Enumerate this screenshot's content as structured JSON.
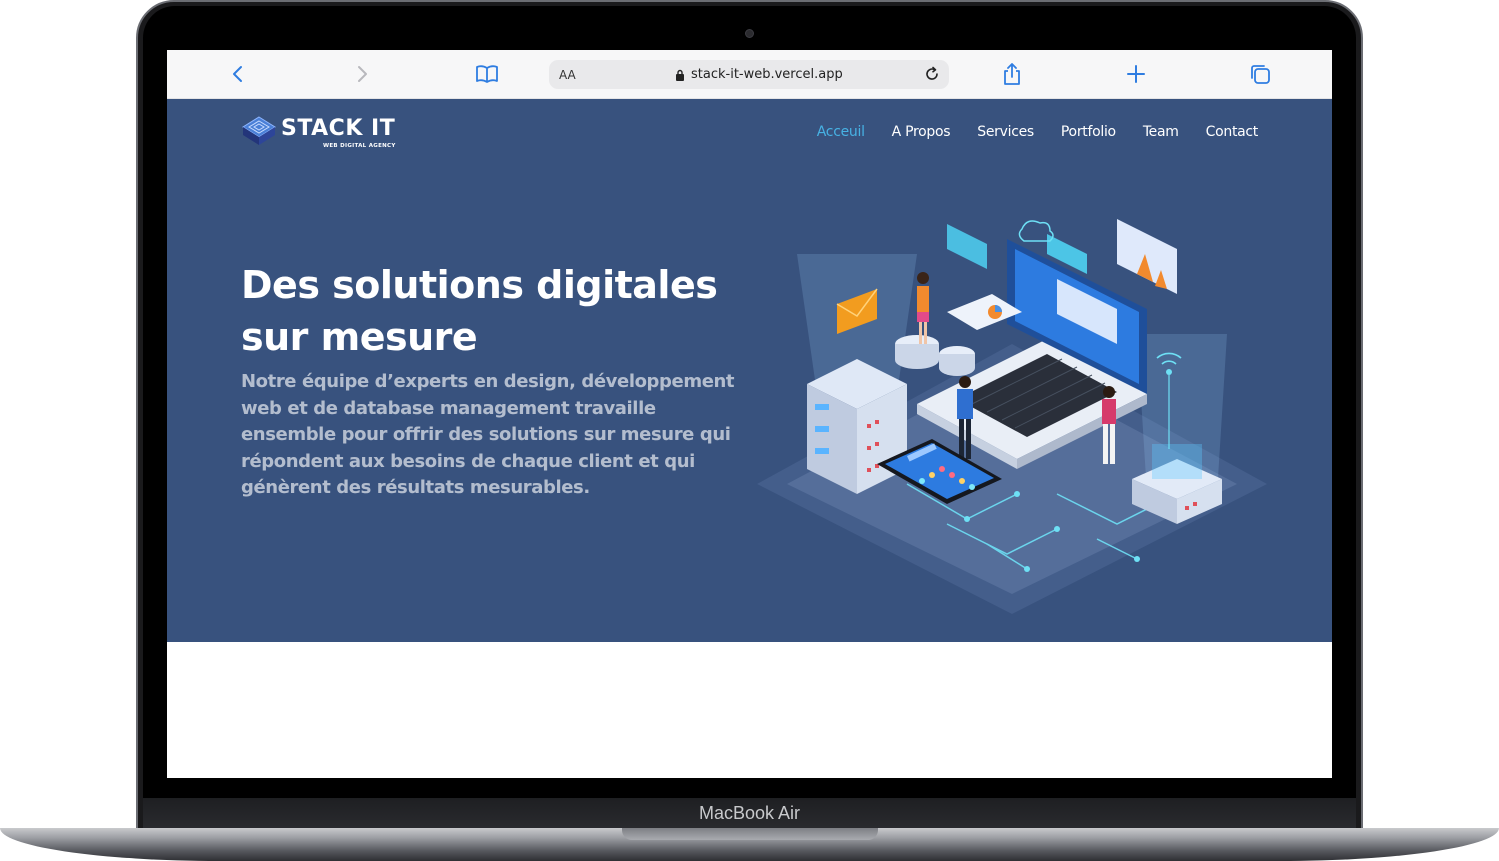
{
  "device": {
    "label": "MacBook Air"
  },
  "browser": {
    "text_size_label": "AA",
    "url": "stack-it-web.vercel.app",
    "icons": [
      "back-icon",
      "forward-icon",
      "bookmarks-icon",
      "lock-icon",
      "reload-icon",
      "share-icon",
      "new-tab-icon",
      "tabs-icon"
    ]
  },
  "site": {
    "logo": {
      "title": "STACK IT",
      "subtitle": "WEB DIGITAL AGENCY"
    },
    "nav": [
      {
        "label": "Acceuil",
        "active": true
      },
      {
        "label": "A Propos",
        "active": false
      },
      {
        "label": "Services",
        "active": false
      },
      {
        "label": "Portfolio",
        "active": false
      },
      {
        "label": "Team",
        "active": false
      },
      {
        "label": "Contact",
        "active": false
      }
    ],
    "hero": {
      "title_line1": "Des solutions digitales",
      "title_line2": "sur mesure",
      "description": "Notre équipe d’experts en design, développement web et de database management travaille ensemble pour offrir des solutions sur mesure qui répondent aux besoins de chaque client et qui génèrent des résultats mesurables."
    }
  },
  "colors": {
    "hero_background": "#38527e",
    "nav_active": "#47b2e4",
    "browser_accent": "#2f7de1"
  }
}
